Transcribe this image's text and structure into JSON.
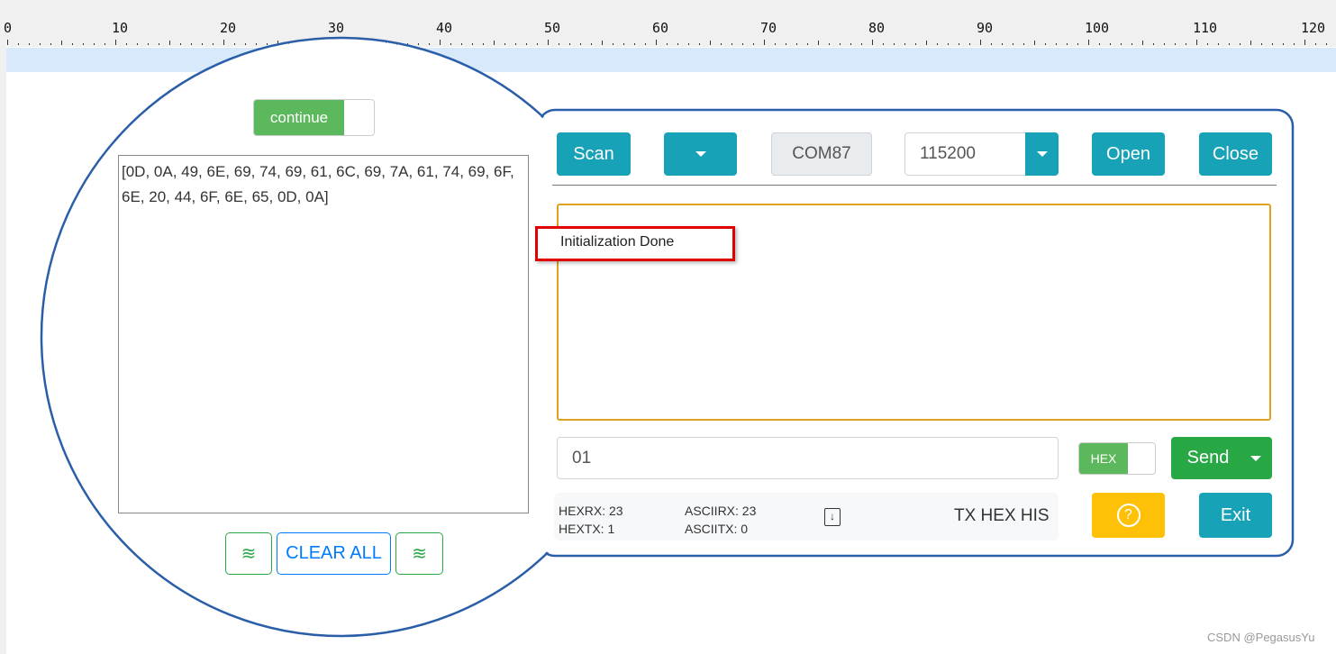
{
  "ruler": {
    "ticks": [
      "0",
      "10",
      "20",
      "30",
      "40",
      "50",
      "60",
      "70",
      "80",
      "90",
      "100",
      "110",
      "120"
    ]
  },
  "left": {
    "toggle_label": "continue",
    "hex_output": "[0D, 0A, 49, 6E, 69, 74, 69, 61, 6C, 69, 7A, 61, 74, 69, 6F, 6E, 20, 44, 6F, 6E, 65, 0D, 0A]",
    "clear_all": "CLEAR ALL"
  },
  "toolbar": {
    "scan": "Scan",
    "port": "COM87",
    "baud": "115200",
    "open": "Open",
    "close": "Close"
  },
  "receive": {
    "text": "Initialization Done"
  },
  "send": {
    "input_value": "01",
    "hex_toggle": "HEX",
    "send": "Send"
  },
  "stats": {
    "hexrx_label": "HEXRX:",
    "hexrx": "23",
    "hextx_label": "HEXTX:",
    "hextx": "1",
    "asciirx_label": "ASCIIRX:",
    "asciirx": "23",
    "asciitx_label": "ASCIITX:",
    "asciitx": "0",
    "history": "TX HEX HIS"
  },
  "actions": {
    "exit": "Exit"
  },
  "watermark": "CSDN @PegasusYu",
  "colors": {
    "teal": "#17a2b8",
    "green": "#28a745",
    "yellow": "#ffc107",
    "outline": "#2a5ea8",
    "highlight": "#e00000",
    "receive_border": "#e0a020"
  }
}
